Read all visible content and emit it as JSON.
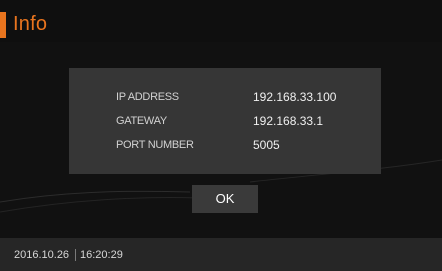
{
  "header": {
    "title": "Info",
    "accent_color": "#e8741e"
  },
  "info": {
    "rows": [
      {
        "label": "IP ADDRESS",
        "value": "192.168.33.100"
      },
      {
        "label": "GATEWAY",
        "value": "192.168.33.1"
      },
      {
        "label": "PORT NUMBER",
        "value": "5005"
      }
    ]
  },
  "dialog": {
    "ok_label": "OK"
  },
  "footer": {
    "date": "2016.10.26",
    "time": "16:20:29"
  }
}
